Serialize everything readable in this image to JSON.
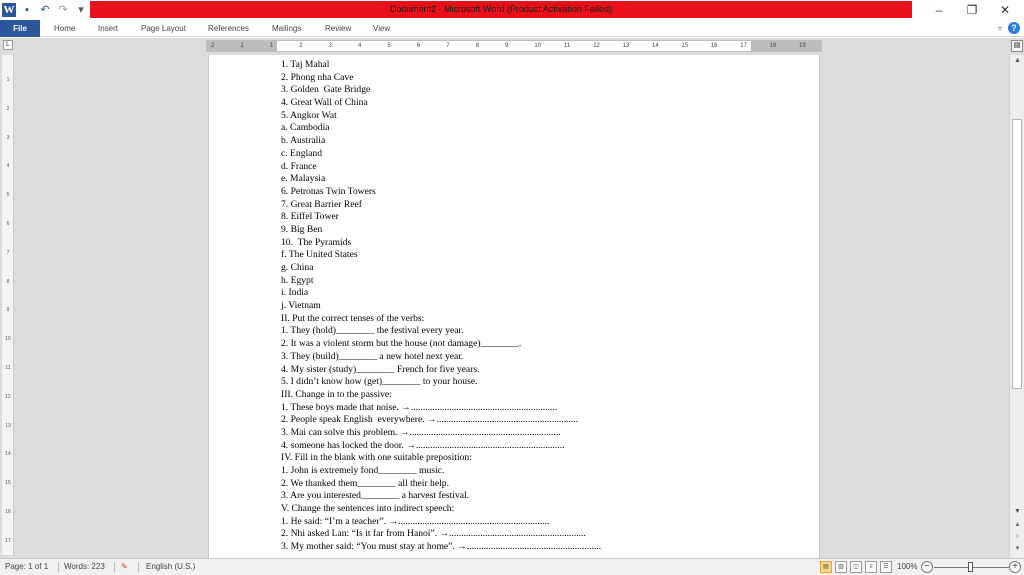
{
  "window": {
    "title": "Document2 - Microsoft Word (Product Activation Failed)",
    "word_icon": "W",
    "minimize": "–",
    "restore": "❐",
    "close": "✕"
  },
  "ribbon": {
    "tabs": [
      "File",
      "Home",
      "Insert",
      "Page Layout",
      "References",
      "Mailings",
      "Review",
      "View"
    ]
  },
  "ruler": {
    "corner": "L",
    "h_numbers": [
      "2",
      "1",
      "1",
      "2",
      "3",
      "4",
      "5",
      "6",
      "7",
      "8",
      "9",
      "10",
      "11",
      "12",
      "13",
      "14",
      "15",
      "16",
      "17",
      "18",
      "19"
    ],
    "v_numbers": [
      "1",
      "2",
      "3",
      "4",
      "5",
      "6",
      "7",
      "8",
      "9",
      "10",
      "11",
      "12",
      "13",
      "14",
      "15",
      "16",
      "17"
    ]
  },
  "document": {
    "lines": [
      "1. Taj Mahal",
      "2. Phong nha Cave",
      "3. Golden  Gate Bridge",
      "4. Great Wall of China",
      "5. Angkor Wat",
      "a. Cambodia",
      "b. Australia",
      "c. England",
      "d. France",
      "e. Malaysia",
      "6. Petronas Twin Towers",
      "7. Great Barrier Reef",
      "8. Eiffel Tower",
      "9. Big Ben",
      "10.  The Pyramids",
      "f. The United States",
      "g. China",
      "h. Egypt",
      "i. India",
      "j. Vietnam",
      "II. Put the correct tenses of the verbs:",
      "1. They (hold)________ the festival every year.",
      "2. It was a violent storm but the house (not damage)________.",
      "3. They (build)________ a new hotel next year.",
      "4. My sister (study)________ French for five years.",
      "5. I didn’t know how (get)________ to your house.",
      "III. Change in to the passive:",
      "1. These boys made that noise. →.............................................................",
      "2. People speak English  everywhere. →...........................................................",
      "3. Mai can solve this problem. →...............................................................",
      "4. someone has locked the door. →..............................................................",
      "IV. Fill in the blank with one suitable preposition:",
      "1. John is extremely fond________ music.",
      "2. We thanked them________ all their help.",
      "3. Are you interested________ a harvest festival.",
      "V. Change the sentences into indirect speech:",
      "1. He said: “I’m a teacher”. →...............................................................",
      "2. Nhi asked Lan: “Is it far from Hanoi”. →.........................................................",
      "3. My mother said: “You must stay at home”. →........................................................"
    ]
  },
  "statusbar": {
    "page": "Page: 1 of 1",
    "words": "Words: 223",
    "language": "English (U.S.)",
    "zoom": "100%",
    "zoom_level_fraction": 0.5
  }
}
